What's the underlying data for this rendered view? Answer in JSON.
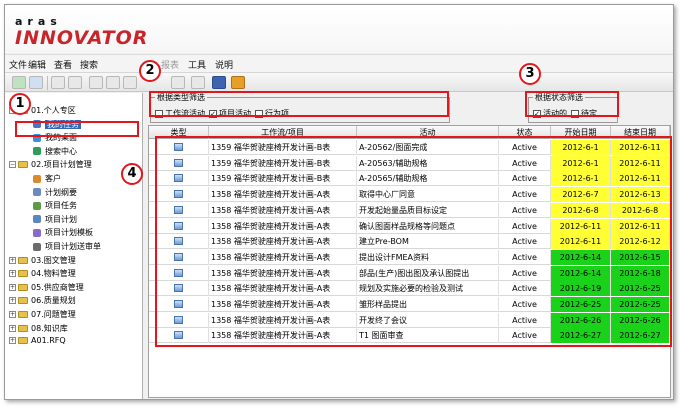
{
  "brand": {
    "small": "aras",
    "big": "INNOVATOR",
    "accent": "#c8242a"
  },
  "menu": [
    {
      "label": "文件",
      "disabled": false
    },
    {
      "label": "编辑",
      "disabled": false
    },
    {
      "label": "查看",
      "disabled": false
    },
    {
      "label": "搜索",
      "disabled": false
    },
    {
      "label": "报表",
      "disabled": true
    },
    {
      "label": "工具",
      "disabled": false
    },
    {
      "label": "说明",
      "disabled": false
    }
  ],
  "sidebar": {
    "items": [
      {
        "label": "01.个人专区",
        "kind": "folder",
        "expander": "−",
        "level": 0
      },
      {
        "label": "我的任务",
        "kind": "item",
        "icon": "task-icon",
        "level": 1,
        "selected": true
      },
      {
        "label": "我的桌面",
        "kind": "item",
        "icon": "desktop-icon",
        "level": 1
      },
      {
        "label": "搜索中心",
        "kind": "item",
        "icon": "search-center-icon",
        "level": 1
      },
      {
        "label": "02.项目计划管理",
        "kind": "folder",
        "expander": "−",
        "level": 0
      },
      {
        "label": "客户",
        "kind": "item",
        "icon": "customer-icon",
        "level": 1
      },
      {
        "label": "计划纲要",
        "kind": "item",
        "icon": "plan-outline-icon",
        "level": 1
      },
      {
        "label": "项目任务",
        "kind": "item",
        "icon": "project-task-icon",
        "level": 1
      },
      {
        "label": "项目计划",
        "kind": "item",
        "icon": "project-plan-icon",
        "level": 1
      },
      {
        "label": "项目计划模板",
        "kind": "item",
        "icon": "plan-template-icon",
        "level": 1
      },
      {
        "label": "项目计划送审单",
        "kind": "item",
        "icon": "plan-review-icon",
        "level": 1
      },
      {
        "label": "03.图文管理",
        "kind": "folder",
        "expander": "+",
        "level": 0
      },
      {
        "label": "04.物料管理",
        "kind": "folder",
        "expander": "+",
        "level": 0
      },
      {
        "label": "05.供应商管理",
        "kind": "folder",
        "expander": "+",
        "level": 0
      },
      {
        "label": "06.质量规划",
        "kind": "folder",
        "expander": "+",
        "level": 0
      },
      {
        "label": "07.问题管理",
        "kind": "folder",
        "expander": "+",
        "level": 0
      },
      {
        "label": "08.知识库",
        "kind": "folder",
        "expander": "+",
        "level": 0
      },
      {
        "label": "A01.RFQ",
        "kind": "folder",
        "expander": "+",
        "level": 0
      }
    ]
  },
  "filters": {
    "type": {
      "legend": "根据类型筛选",
      "options": [
        {
          "label": "工作流活动",
          "checked": false
        },
        {
          "label": "项目活动",
          "checked": true
        },
        {
          "label": "行为项",
          "checked": false
        }
      ]
    },
    "status": {
      "legend": "根据状态筛选",
      "options": [
        {
          "label": "活动的",
          "checked": true
        },
        {
          "label": "待定",
          "checked": false
        }
      ]
    }
  },
  "table": {
    "headers": [
      "类型",
      "工作流/项目",
      "活动",
      "状态",
      "开始日期",
      "结束日期"
    ],
    "rows": [
      {
        "project": "1359 福华贺驶座椅开发计画-B表",
        "activity": "A-20562/图面完成",
        "status": "Active",
        "start": "2012-6-1",
        "end": "2012-6-11",
        "start_color": "yellow",
        "end_color": "yellow"
      },
      {
        "project": "1359 福华贺驶座椅开发计画-B表",
        "activity": "A-20563/辅助规格",
        "status": "Active",
        "start": "2012-6-1",
        "end": "2012-6-11",
        "start_color": "yellow",
        "end_color": "yellow"
      },
      {
        "project": "1359 福华贺驶座椅开发计画-B表",
        "activity": "A-20565/辅助规格",
        "status": "Active",
        "start": "2012-6-1",
        "end": "2012-6-11",
        "start_color": "yellow",
        "end_color": "yellow"
      },
      {
        "project": "1358 福华贺驶座椅开发计画-A表",
        "activity": "取得中心厂同意",
        "status": "Active",
        "start": "2012-6-7",
        "end": "2012-6-13",
        "start_color": "yellow",
        "end_color": "yellow"
      },
      {
        "project": "1358 福华贺驶座椅开发计画-A表",
        "activity": "开发起始量品质目标设定",
        "status": "Active",
        "start": "2012-6-8",
        "end": "2012-6-8",
        "start_color": "yellow",
        "end_color": "yellow"
      },
      {
        "project": "1358 福华贺驶座椅开发计画-A表",
        "activity": "确认图面样品规格等问题点",
        "status": "Active",
        "start": "2012-6-11",
        "end": "2012-6-11",
        "start_color": "yellow",
        "end_color": "yellow"
      },
      {
        "project": "1358 福华贺驶座椅开发计画-A表",
        "activity": "建立Pre-BOM",
        "status": "Active",
        "start": "2012-6-11",
        "end": "2012-6-12",
        "start_color": "yellow",
        "end_color": "yellow"
      },
      {
        "project": "1358 福华贺驶座椅开发计画-A表",
        "activity": "提出设计FMEA资料",
        "status": "Active",
        "start": "2012-6-14",
        "end": "2012-6-15",
        "start_color": "green",
        "end_color": "green"
      },
      {
        "project": "1358 福华贺驶座椅开发计画-A表",
        "activity": "部品(生产)图出图及承认图提出",
        "status": "Active",
        "start": "2012-6-14",
        "end": "2012-6-18",
        "start_color": "green",
        "end_color": "green"
      },
      {
        "project": "1358 福华贺驶座椅开发计画-A表",
        "activity": "规划及实施必要的检验及测试",
        "status": "Active",
        "start": "2012-6-19",
        "end": "2012-6-25",
        "start_color": "green",
        "end_color": "green"
      },
      {
        "project": "1358 福华贺驶座椅开发计画-A表",
        "activity": "雏形样品提出",
        "status": "Active",
        "start": "2012-6-25",
        "end": "2012-6-25",
        "start_color": "green",
        "end_color": "green"
      },
      {
        "project": "1358 福华贺驶座椅开发计画-A表",
        "activity": "开发终了会议",
        "status": "Active",
        "start": "2012-6-26",
        "end": "2012-6-26",
        "start_color": "green",
        "end_color": "green"
      },
      {
        "project": "1358 福华贺驶座椅开发计画-A表",
        "activity": "T1 图面审查",
        "status": "Active",
        "start": "2012-6-27",
        "end": "2012-6-27",
        "start_color": "green",
        "end_color": "green"
      }
    ]
  },
  "callouts": [
    "1",
    "2",
    "3",
    "4"
  ],
  "colors": {
    "yellow": "#ffff33",
    "green": "#19d219",
    "callout": "#e3171b",
    "selected": "#3565b5"
  }
}
